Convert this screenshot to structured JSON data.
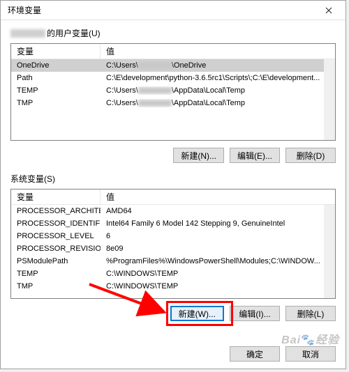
{
  "title": "环境变量",
  "userSection": {
    "labelSuffix": "的用户变量(U)",
    "col1": "变量",
    "col2": "值",
    "rows": [
      {
        "name": "OneDrive",
        "val_prefix": "C:\\Users\\",
        "val_suffix": "\\OneDrive",
        "blurred": true
      },
      {
        "name": "Path",
        "val": "C:\\E\\development\\python-3.6.5rc1\\Scripts\\;C:\\E\\development..."
      },
      {
        "name": "TEMP",
        "val_prefix": "C:\\Users\\",
        "val_suffix": "\\AppData\\Local\\Temp",
        "blurred": true
      },
      {
        "name": "TMP",
        "val_prefix": "C:\\Users\\",
        "val_suffix": "\\AppData\\Local\\Temp",
        "blurred": true
      }
    ],
    "buttons": {
      "new": "新建(N)...",
      "edit": "编辑(E)...",
      "del": "删除(D)"
    }
  },
  "sysSection": {
    "label": "系统变量(S)",
    "col1": "变量",
    "col2": "值",
    "rows": [
      {
        "name": "PROCESSOR_ARCHITECT",
        "val": "AMD64"
      },
      {
        "name": "PROCESSOR_IDENTIFIER",
        "val": "Intel64 Family 6 Model 142 Stepping 9, GenuineIntel"
      },
      {
        "name": "PROCESSOR_LEVEL",
        "val": "6"
      },
      {
        "name": "PROCESSOR_REVISION",
        "val": "8e09"
      },
      {
        "name": "PSModulePath",
        "val": "%ProgramFiles%\\WindowsPowerShell\\Modules;C:\\WINDOW..."
      },
      {
        "name": "TEMP",
        "val": "C:\\WINDOWS\\TEMP"
      },
      {
        "name": "TMP",
        "val": "C:\\WINDOWS\\TEMP"
      }
    ],
    "buttons": {
      "new": "新建(W)...",
      "edit": "编辑(I)...",
      "del": "删除(L)"
    }
  },
  "bottom": {
    "ok": "确定",
    "cancel": "取消"
  },
  "watermark": "Bai",
  "watermark2": "经验"
}
